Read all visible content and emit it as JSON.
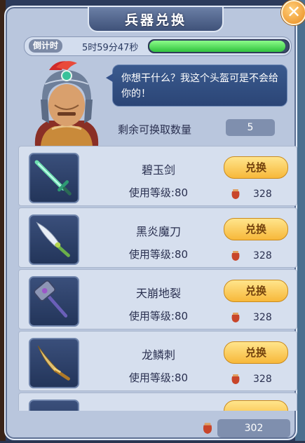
{
  "title": "兵器兑换",
  "close_icon": "close-icon",
  "timer": {
    "label": "倒计时",
    "remaining": "5时59分47秒",
    "progress_fraction": 0.97
  },
  "npc": {
    "speech": "你想干什么？我这个头盔可是不会给你的！"
  },
  "remaining": {
    "label": "剩余可换取数量",
    "value": "5"
  },
  "items": [
    {
      "name": "碧玉剑",
      "level": "使用等级:80",
      "button": "兑换",
      "cost": "328",
      "icon": "jade-sword-icon"
    },
    {
      "name": "黑炎魔刀",
      "level": "使用等级:80",
      "button": "兑换",
      "cost": "328",
      "icon": "dark-blade-icon"
    },
    {
      "name": "天崩地裂",
      "level": "使用等级:80",
      "button": "兑换",
      "cost": "328",
      "icon": "war-hammer-icon"
    },
    {
      "name": "龙鳞刺",
      "level": "使用等级:80",
      "button": "兑换",
      "cost": "328",
      "icon": "dragon-dagger-icon"
    }
  ],
  "currency": {
    "value": "302",
    "icon": "pot-icon"
  },
  "colors": {
    "accent": "#f7b83a",
    "panel": "#b9c6dd",
    "progress": "#2fc23d"
  }
}
